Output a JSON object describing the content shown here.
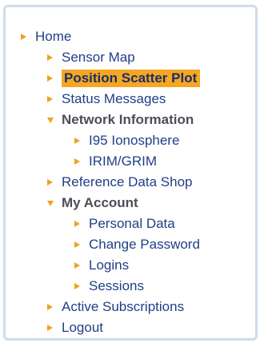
{
  "nav": {
    "home": "Home",
    "sensor_map": "Sensor Map",
    "position_scatter_plot": "Position Scatter Plot",
    "status_messages": "Status Messages",
    "network_information": "Network Information",
    "i95_ionosphere": "I95 Ionosphere",
    "irim_grim": "IRIM/GRIM",
    "reference_data_shop": "Reference Data Shop",
    "my_account": "My Account",
    "personal_data": "Personal Data",
    "change_password": "Change Password",
    "logins": "Logins",
    "sessions": "Sessions",
    "active_subscriptions": "Active Subscriptions",
    "logout": "Logout"
  },
  "colors": {
    "arrow": "#f0a21a",
    "link": "#1f3f86",
    "section": "#4a4f57",
    "active_bg": "#f5a623",
    "panel_border": "#cfdcec"
  },
  "icons": {
    "collapsed": "arrow-right-icon",
    "expanded": "arrow-down-icon"
  },
  "active_item": "position_scatter_plot"
}
